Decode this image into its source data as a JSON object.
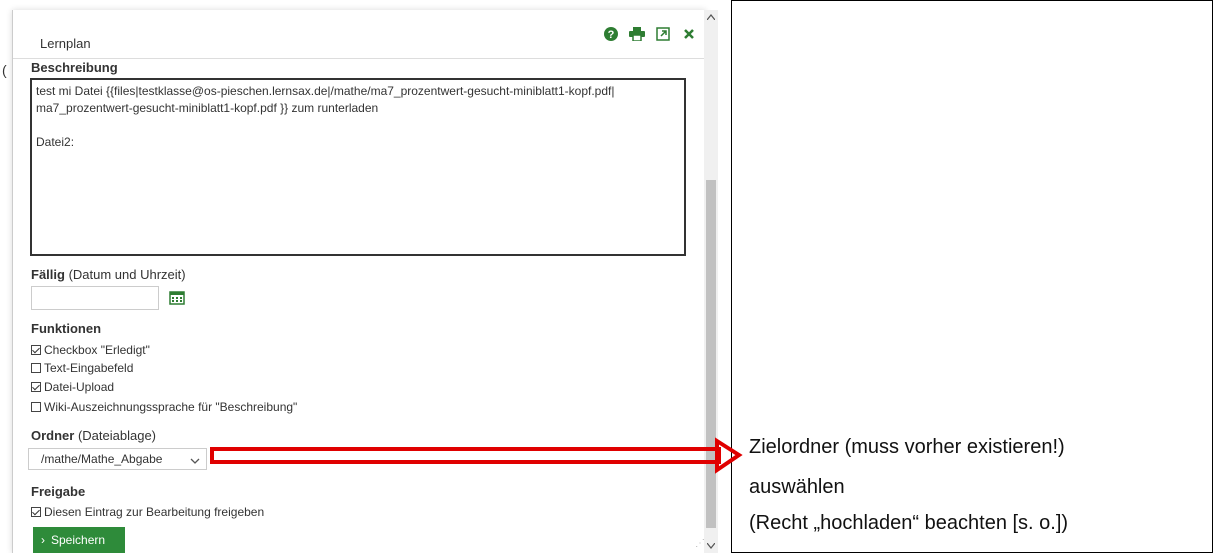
{
  "dialog": {
    "title": "Lernplan",
    "icons": [
      "help-icon",
      "print-icon",
      "popout-icon",
      "close-icon"
    ]
  },
  "beschreibung": {
    "label": "Beschreibung",
    "text": "test mi Datei {{files|testklasse@os-pieschen.lernsax.de|/mathe/ma7_prozentwert-gesucht-miniblatt1-kopf.pdf| ma7_prozentwert-gesucht-miniblatt1-kopf.pdf }} zum runterladen\n\nDatei2:"
  },
  "faellig": {
    "label": "Fällig",
    "sub": "(Datum und Uhrzeit)",
    "value": ""
  },
  "funktionen": {
    "label": "Funktionen",
    "items": [
      {
        "label": "Checkbox \"Erledigt\"",
        "checked": true
      },
      {
        "label": "Text-Eingabefeld",
        "checked": false
      },
      {
        "label": "Datei-Upload",
        "checked": true
      },
      {
        "label": "Wiki-Auszeichnungssprache für \"Beschreibung\"",
        "checked": false
      }
    ]
  },
  "ordner": {
    "label": "Ordner",
    "sub": "(Dateiablage)",
    "selected": "/mathe/Mathe_Abgabe"
  },
  "freigabe": {
    "label": "Freigabe",
    "item": {
      "label": "Diesen Eintrag zur Bearbeitung freigeben",
      "checked": true
    }
  },
  "save_label": "Speichern",
  "annotation": {
    "line1": "Zielordner (muss vorher existieren!)",
    "line2": "auswählen",
    "line3": "(Recht „hochladen“ beachten [s. o.])"
  },
  "colors": {
    "accent": "#2e8b3a",
    "arrow": "#e00000"
  }
}
